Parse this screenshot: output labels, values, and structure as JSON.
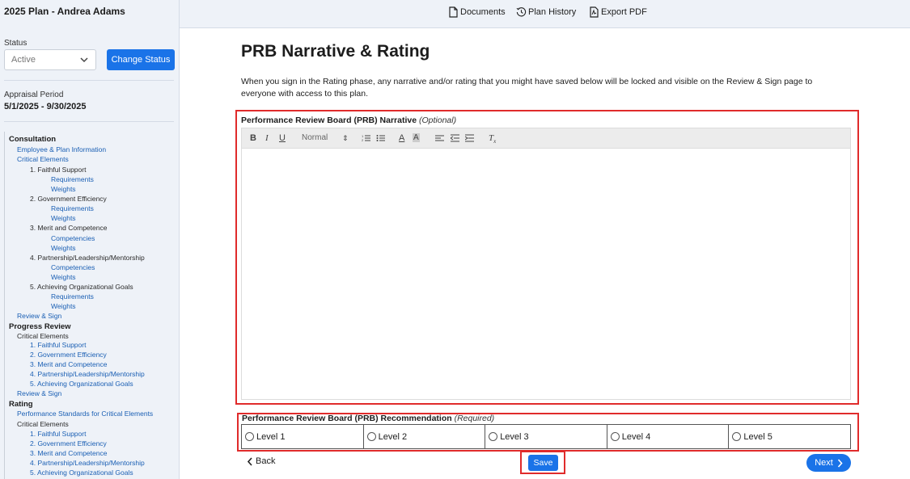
{
  "sidebar": {
    "plan_title": "2025 Plan - Andrea Adams",
    "status_label": "Status",
    "status_value": "Active",
    "change_status_label": "Change Status",
    "appraisal_label": "Appraisal Period",
    "appraisal_value": "5/1/2025 - 9/30/2025",
    "nav": [
      {
        "text": "Consultation",
        "kind": "section"
      },
      {
        "text": "Employee & Plan Information",
        "kind": "link"
      },
      {
        "text": "Critical Elements",
        "kind": "link"
      },
      {
        "text": "1. Faithful Support",
        "kind": "dark"
      },
      {
        "text": "Requirements",
        "kind": "link"
      },
      {
        "text": "Weights",
        "kind": "link"
      },
      {
        "text": "2. Government Efficiency",
        "kind": "dark"
      },
      {
        "text": "Requirements",
        "kind": "link"
      },
      {
        "text": "Weights",
        "kind": "link"
      },
      {
        "text": "3. Merit and Competence",
        "kind": "dark"
      },
      {
        "text": "Competencies",
        "kind": "link"
      },
      {
        "text": "Weights",
        "kind": "link"
      },
      {
        "text": "4. Partnership/Leadership/Mentorship",
        "kind": "dark"
      },
      {
        "text": "Competencies",
        "kind": "link"
      },
      {
        "text": "Weights",
        "kind": "link"
      },
      {
        "text": "5. Achieving Organizational Goals",
        "kind": "dark"
      },
      {
        "text": "Requirements",
        "kind": "link"
      },
      {
        "text": "Weights",
        "kind": "link"
      },
      {
        "text": "Review & Sign",
        "kind": "link"
      },
      {
        "text": "Progress Review",
        "kind": "section"
      },
      {
        "text": "Critical Elements",
        "kind": "dark"
      },
      {
        "text": "1. Faithful Support",
        "kind": "link"
      },
      {
        "text": "2. Government Efficiency",
        "kind": "link"
      },
      {
        "text": "3. Merit and Competence",
        "kind": "link"
      },
      {
        "text": "4. Partnership/Leadership/Mentorship",
        "kind": "link"
      },
      {
        "text": "5. Achieving Organizational Goals",
        "kind": "link"
      },
      {
        "text": "Review & Sign",
        "kind": "link"
      },
      {
        "text": "Rating",
        "kind": "section"
      },
      {
        "text": "Performance Standards for Critical Elements",
        "kind": "link"
      },
      {
        "text": "Critical Elements",
        "kind": "dark"
      },
      {
        "text": "1. Faithful Support",
        "kind": "link"
      },
      {
        "text": "2. Government Efficiency",
        "kind": "link"
      },
      {
        "text": "3. Merit and Competence",
        "kind": "link"
      },
      {
        "text": "4. Partnership/Leadership/Mentorship",
        "kind": "link"
      },
      {
        "text": "5. Achieving Organizational Goals",
        "kind": "link"
      }
    ]
  },
  "topbar": {
    "documents": "Documents",
    "plan_history": "Plan History",
    "export_pdf": "Export PDF"
  },
  "main": {
    "title": "PRB Narrative & Rating",
    "intro": "When you sign in the Rating phase, any narrative and/or rating that you might have saved below will be locked and visible on the Review & Sign page to everyone with access to this plan.",
    "narrative_label": "Performance Review Board (PRB) Narrative",
    "narrative_optional": "(Optional)",
    "toolbar_format": "Normal",
    "recommendation_label": "Performance Review Board (PRB) Recommendation",
    "recommendation_required": "(Required)",
    "levels": [
      "Level 1",
      "Level 2",
      "Level 3",
      "Level 4",
      "Level 5"
    ],
    "back_label": "Back",
    "save_label": "Save",
    "next_label": "Next"
  },
  "colors": {
    "accent": "#1a73e8",
    "highlight": "#e02b2b",
    "sidebar_bg": "#eef2f8",
    "link": "#1a5fb4"
  }
}
